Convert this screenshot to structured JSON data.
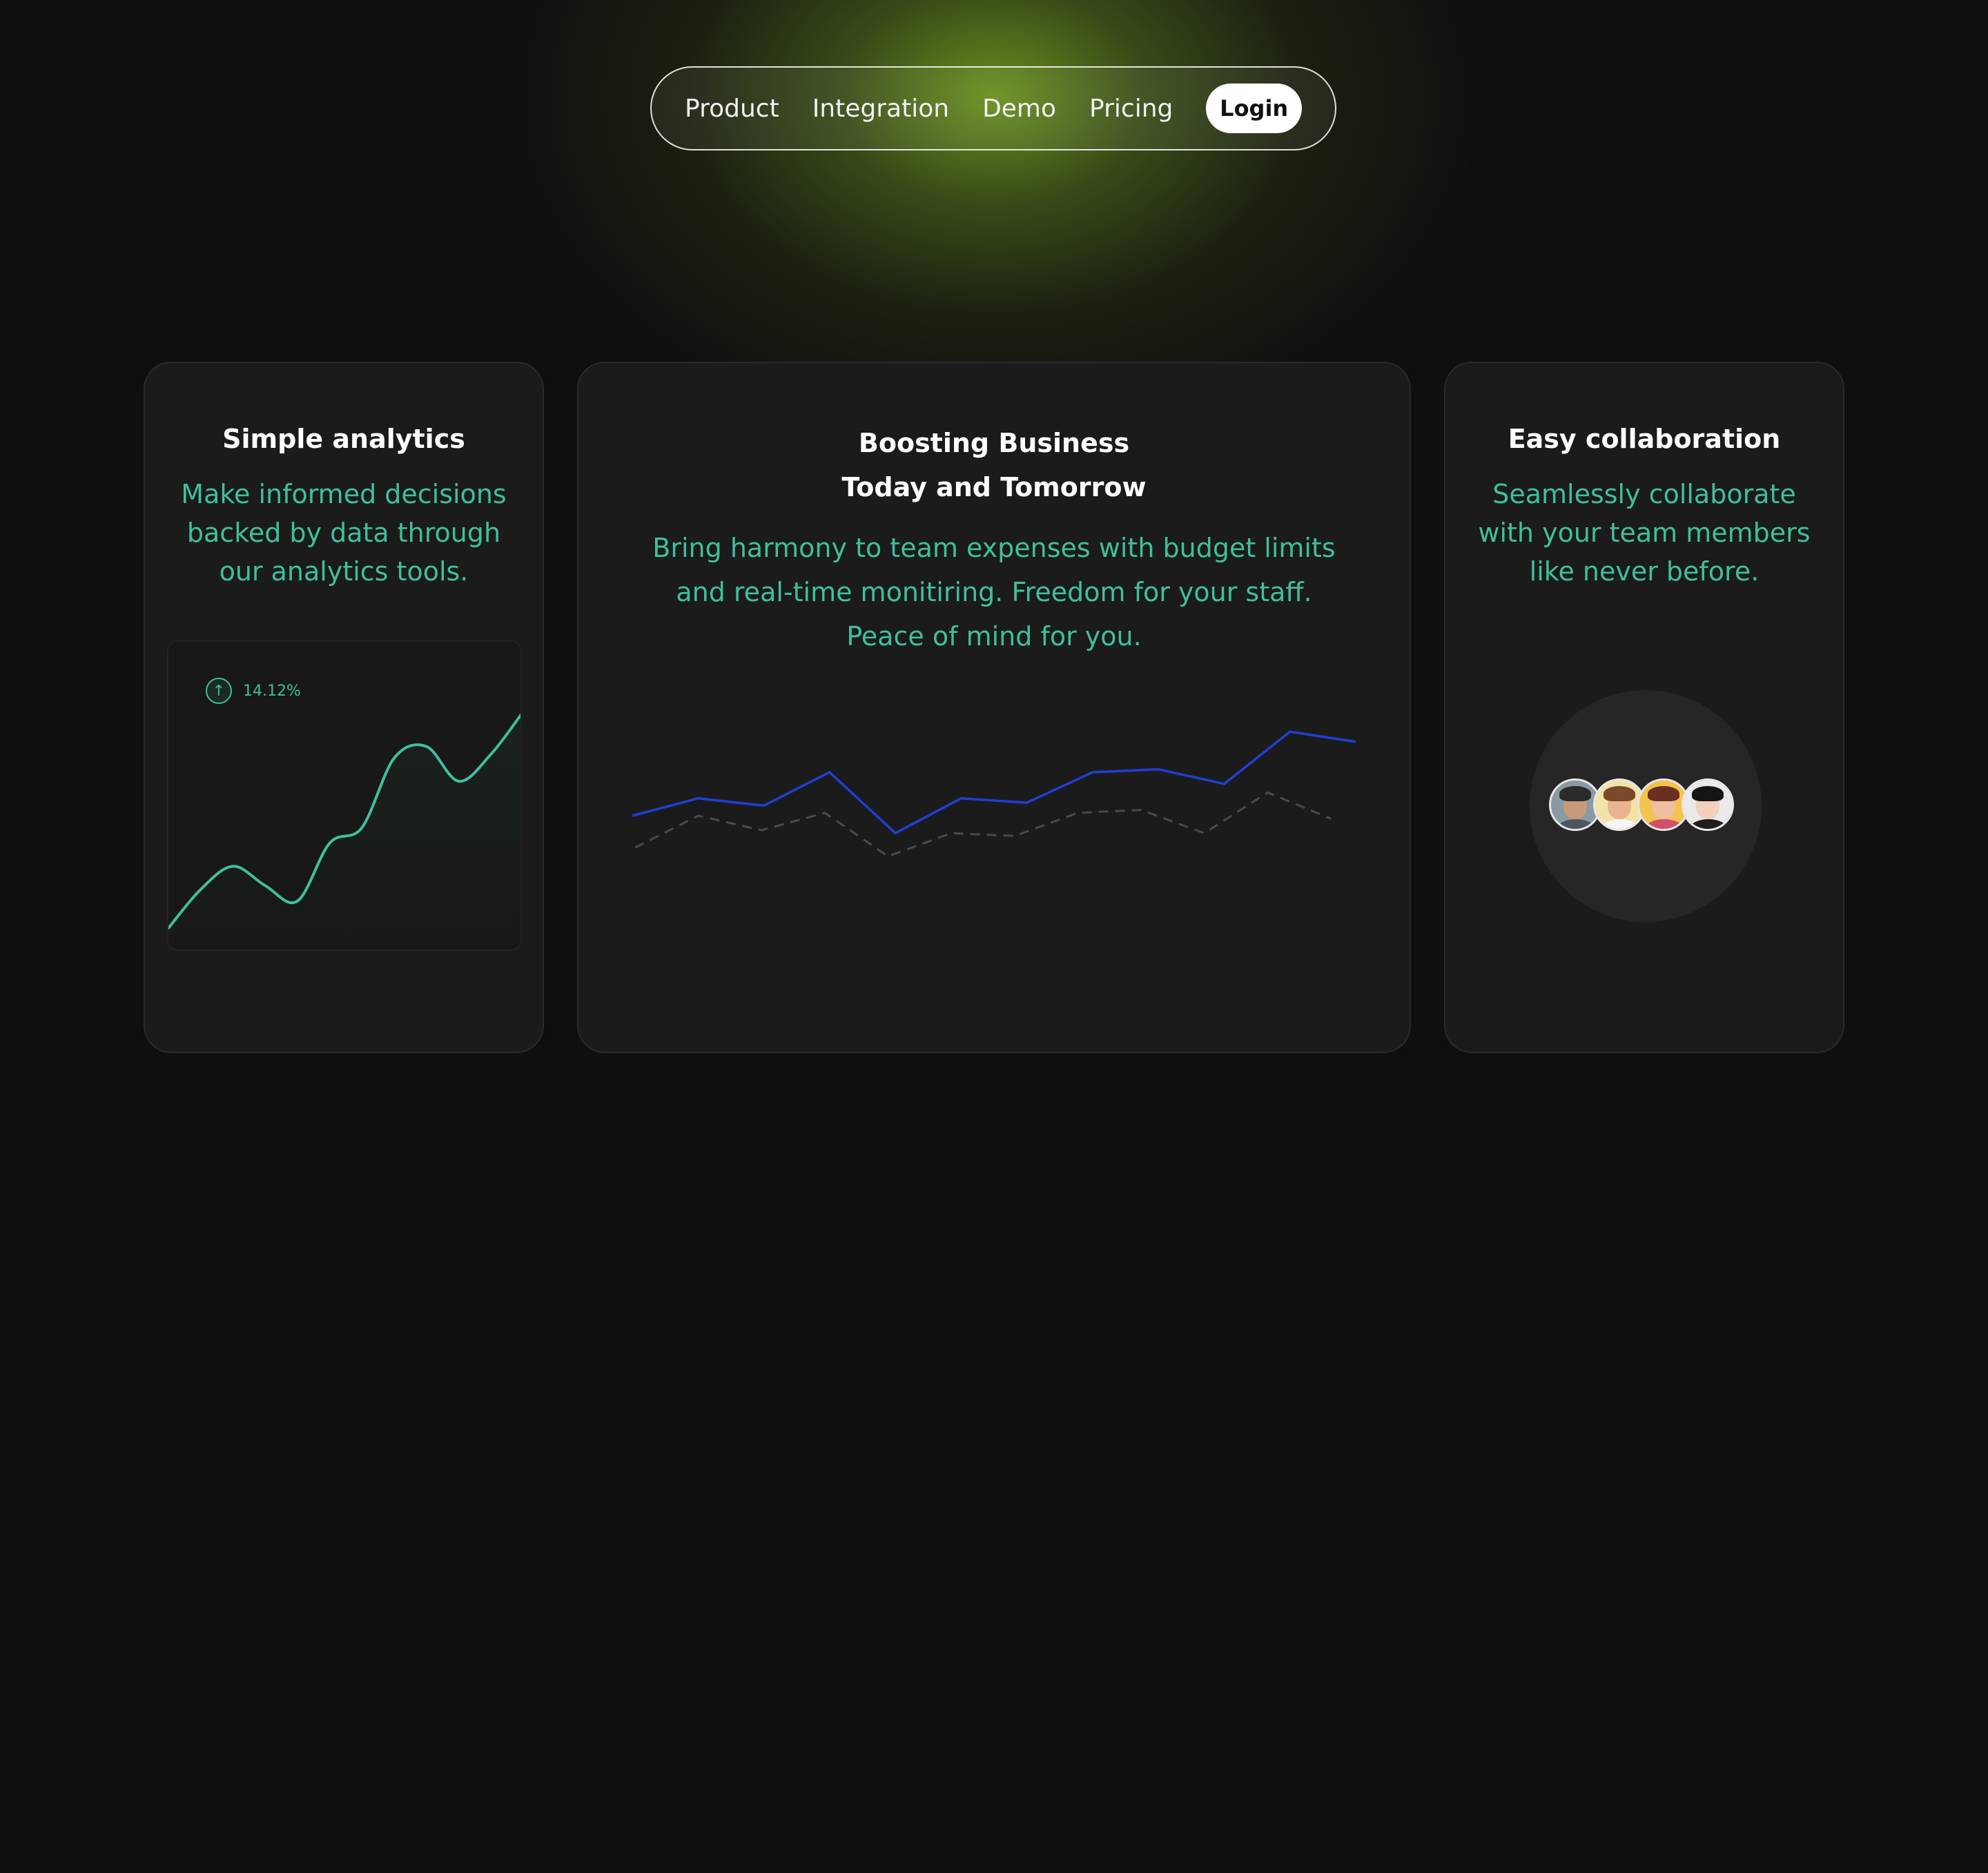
{
  "nav": {
    "links": [
      "Product",
      "Integration",
      "Demo",
      "Pricing"
    ],
    "login_label": "Login"
  },
  "cards": {
    "analytics": {
      "title": "Simple analytics",
      "description": "Make informed decisions backed by data through our analytics tools.",
      "stat_value": "14.12%",
      "stat_icon": "arrow-up-icon"
    },
    "business": {
      "title_line1": "Boosting Business",
      "title_line2": "Today and Tomorrow",
      "description": "Bring harmony to team expenses with budget limits and real-time monitiring. Freedom for your staff. Peace of mind for you."
    },
    "collaboration": {
      "title": "Easy collaboration",
      "description": "Seamlessly collaborate with your team members like never before.",
      "avatars": [
        "avatar-1",
        "avatar-2",
        "avatar-3",
        "avatar-4"
      ]
    }
  },
  "colors": {
    "accent": "#3fbf9e",
    "chart_blue": "#1f3fd6",
    "chart_dashed": "#4a4a4a",
    "background": "#0f0f0f",
    "card": "#1b1b1b",
    "glow": "#6b8e23"
  },
  "chart_data": [
    {
      "type": "line",
      "title": "",
      "series": [
        {
          "values": [
            2,
            12,
            18,
            13,
            9,
            24,
            28,
            46,
            49,
            40,
            47,
            58
          ]
        }
      ],
      "grid": false
    },
    {
      "type": "line",
      "title": "",
      "series": [
        {
          "style": "solid",
          "values": [
            40,
            52,
            47,
            70,
            28,
            52,
            49,
            70,
            72,
            62,
            98,
            91
          ]
        },
        {
          "style": "dashed",
          "values": [
            18,
            40,
            30,
            42,
            12,
            28,
            26,
            42,
            44,
            28,
            56,
            38
          ]
        }
      ],
      "grid": false
    }
  ]
}
